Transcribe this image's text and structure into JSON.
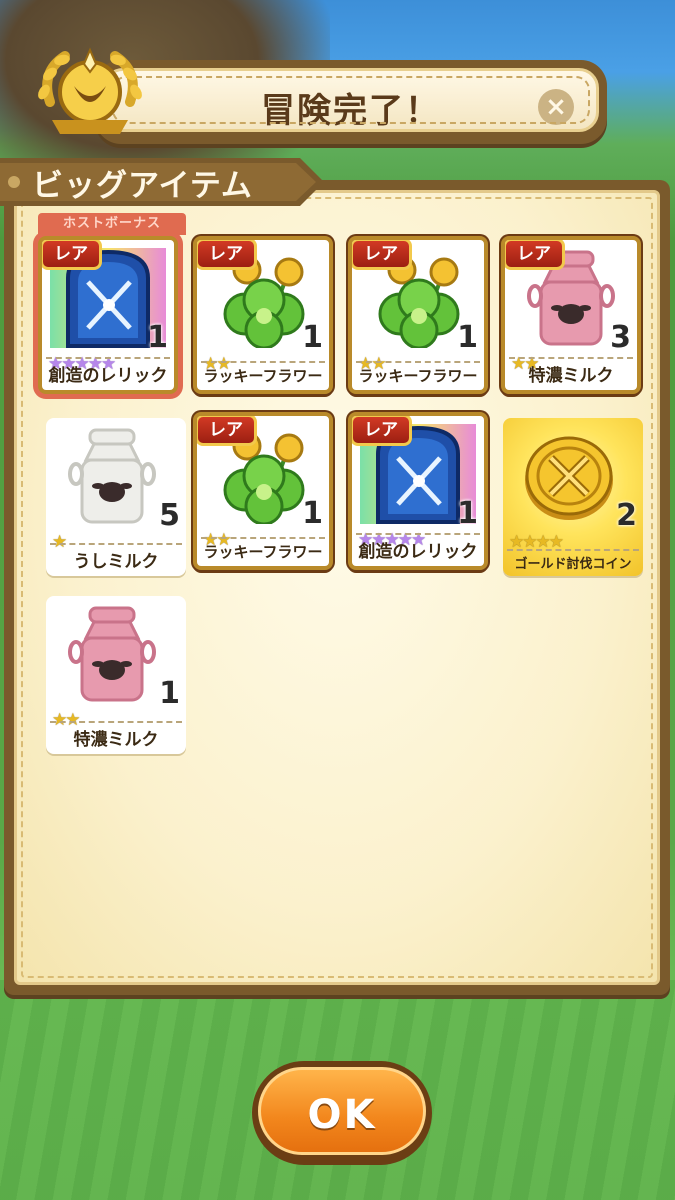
{
  "header": {
    "title": "冒険完了！",
    "close_icon": "close-icon"
  },
  "section": {
    "title": "ビッグアイテム"
  },
  "bonus_label": "ホストボーナス",
  "rare_label": "レア",
  "items": [
    {
      "name": "創造のレリック",
      "count": "1",
      "stars": 5,
      "star_color": "purple",
      "rare": true,
      "bonus": true,
      "icon": "relic-tablet-icon"
    },
    {
      "name": "ラッキーフラワー",
      "count": "1",
      "stars": 2,
      "star_color": "gold",
      "rare": true,
      "bonus": false,
      "icon": "lucky-flower-icon"
    },
    {
      "name": "ラッキーフラワー",
      "count": "1",
      "stars": 2,
      "star_color": "gold",
      "rare": true,
      "bonus": false,
      "icon": "lucky-flower-icon"
    },
    {
      "name": "特濃ミルク",
      "count": "3",
      "stars": 2,
      "star_color": "gold",
      "rare": true,
      "bonus": false,
      "icon": "pink-milk-can-icon"
    },
    {
      "name": "うしミルク",
      "count": "5",
      "stars": 1,
      "star_color": "gold",
      "rare": false,
      "bonus": false,
      "icon": "white-milk-can-icon"
    },
    {
      "name": "ラッキーフラワー",
      "count": "1",
      "stars": 2,
      "star_color": "gold",
      "rare": true,
      "bonus": false,
      "icon": "lucky-flower-icon"
    },
    {
      "name": "創造のレリック",
      "count": "1",
      "stars": 5,
      "star_color": "purple",
      "rare": true,
      "bonus": false,
      "icon": "relic-tablet-icon"
    },
    {
      "name": "ゴールド討伐コイン",
      "count": "2",
      "stars": 4,
      "star_color": "gold",
      "rare": false,
      "bonus": false,
      "icon": "gold-coin-icon"
    },
    {
      "name": "特濃ミルク",
      "count": "1",
      "stars": 2,
      "star_color": "gold",
      "rare": false,
      "bonus": false,
      "icon": "pink-milk-can-icon"
    }
  ],
  "ok_button": {
    "label": "OK"
  }
}
